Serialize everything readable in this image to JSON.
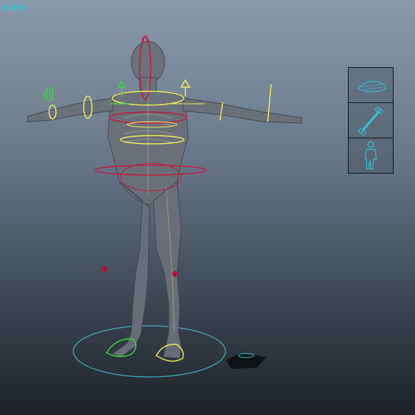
{
  "colors": {
    "background_top": "#8a9aab",
    "background_bottom": "#1c2228",
    "ik_yellow": "#f3f05a",
    "fk_green": "#3ad83a",
    "spine_red": "#c8143c",
    "ground_ring": "#3fb6c3",
    "picker_cyan": "#31c4d3"
  },
  "viewport": {
    "object": "rigged-human-body",
    "controls": [
      "hand-ik-control",
      "wrist-control",
      "shoulder-control",
      "head-control",
      "chest-control",
      "hip-control",
      "knee-pole-vector",
      "foot-control",
      "root-control"
    ]
  },
  "picker": {
    "buttons": [
      {
        "icon": "muscle-layer-icon"
      },
      {
        "icon": "skeleton-layer-icon"
      },
      {
        "icon": "body-layer-icon"
      }
    ]
  },
  "hud_logo": {
    "text": "ЕЗКЯ"
  }
}
